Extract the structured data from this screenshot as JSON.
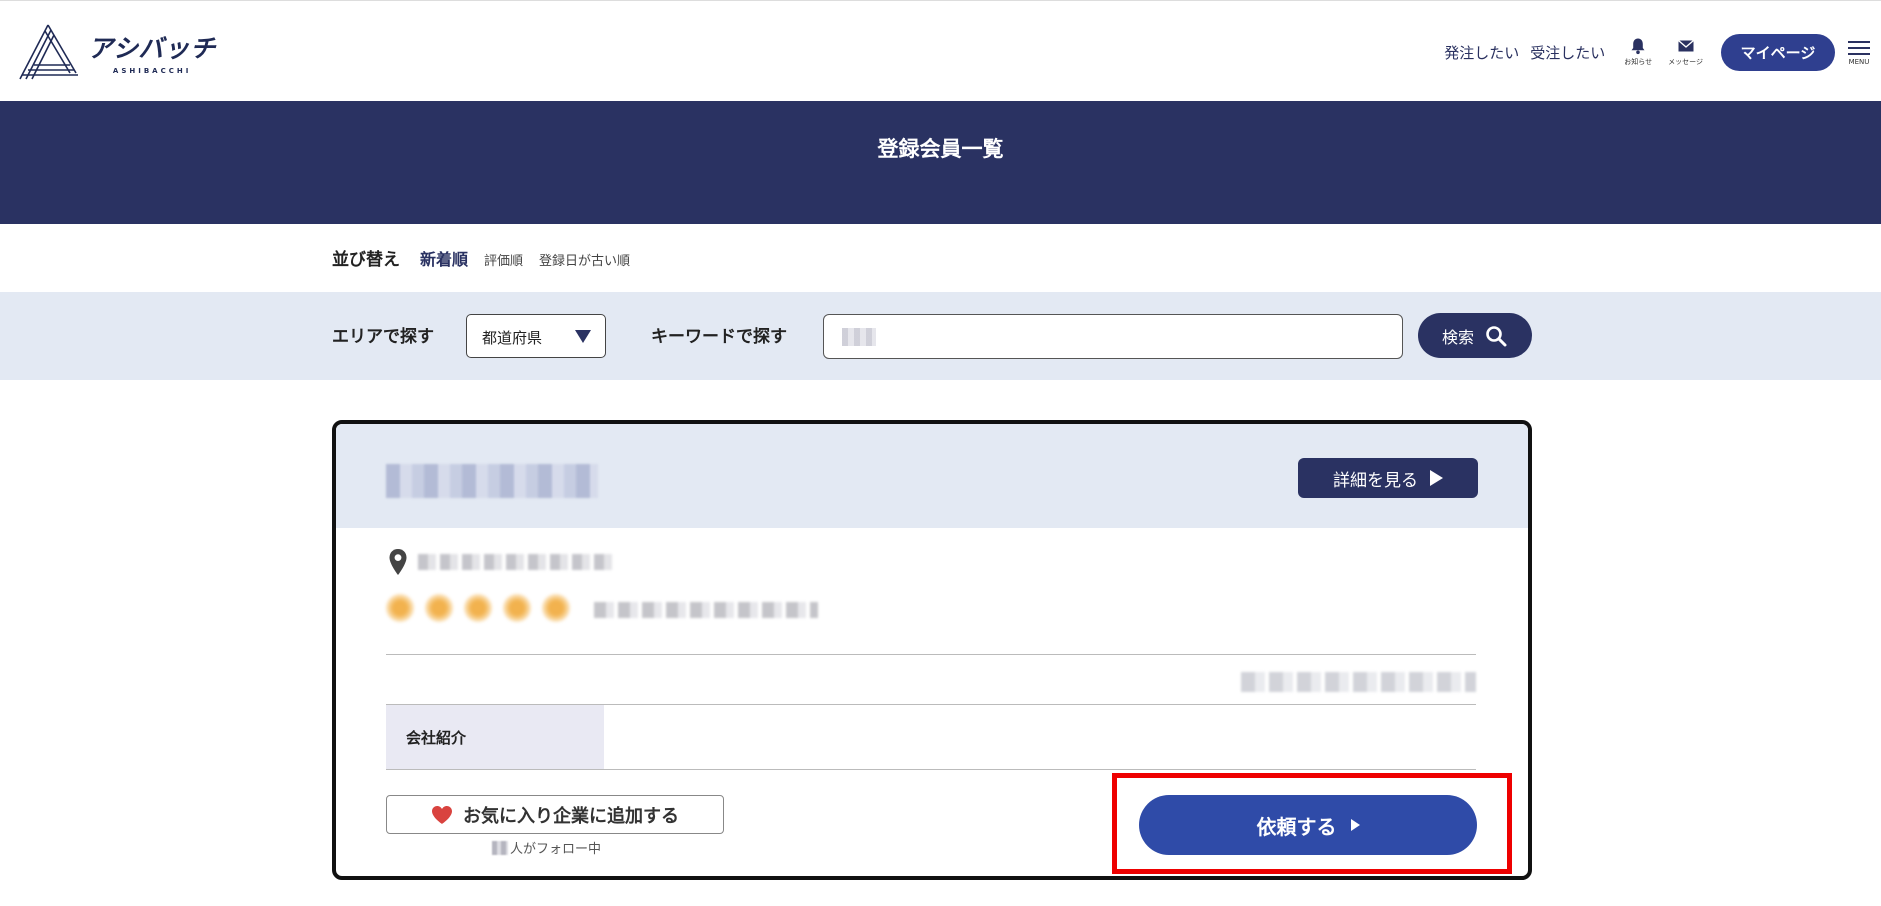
{
  "header": {
    "logo_main": "アシバッチ",
    "logo_sub": "ASHIBACCHI",
    "nav_order": "発注したい",
    "nav_receive": "受注したい",
    "notifications_label": "お知らせ",
    "messages_label": "メッセージ",
    "mypage_label": "マイページ",
    "menu_label": "MENU"
  },
  "banner": {
    "title": "登録会員一覧"
  },
  "sort": {
    "label": "並び替え",
    "active": "新着順",
    "options": [
      "評価順",
      "登録日が古い順"
    ]
  },
  "search": {
    "area_label": "エリアで探す",
    "prefecture_value": "都道府県",
    "keyword_label": "キーワードで探す",
    "keyword_value": "",
    "button_label": "検索"
  },
  "card": {
    "detail_button": "詳細を見る",
    "intro_label": "会社紹介",
    "favorite_button": "お気に入り企業に追加する",
    "follow_suffix": "人がフォロー中",
    "request_button": "依頼する"
  },
  "colors": {
    "navy": "#2a3262",
    "accent_blue": "#2f4ba8",
    "highlight_red": "#ee0000",
    "light_panel": "#e3e9f3"
  }
}
